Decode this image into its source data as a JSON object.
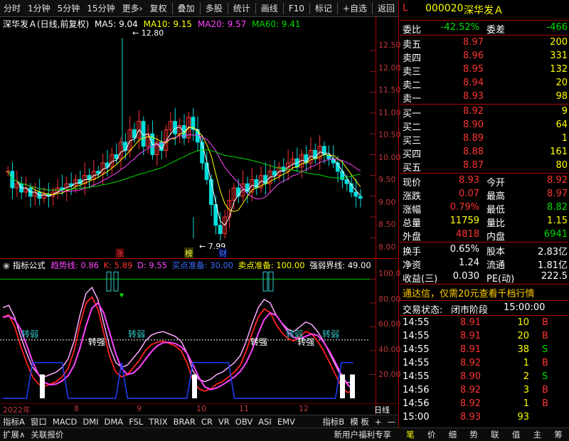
{
  "toolbar": {
    "left": [
      "分时",
      "1分钟",
      "5分钟",
      "15分钟",
      "更多›"
    ],
    "right": [
      "复权",
      "叠加",
      "多股",
      "统计",
      "画线",
      "F10",
      "标记",
      "+自选",
      "返回"
    ]
  },
  "chart": {
    "title": "深华发Ａ(日线,前复权)",
    "ma5": "MA5: 9.04",
    "ma10": "MA10: 9.15",
    "ma20": "MA20: 9.57",
    "ma60": "MA60: 9.41",
    "high_label": "12.80",
    "low_label": "7.99",
    "price_ticks": [
      "12.50",
      "12.00",
      "11.50",
      "11.00",
      "10.50",
      "10.00",
      "9.50",
      "9.00",
      "8.50",
      "8.00"
    ],
    "flags": [
      "涨",
      "榜",
      "财"
    ]
  },
  "indicator": {
    "name": "指标公式",
    "trend": "趋势线: 0.86",
    "k": "K: 5.89",
    "d": "D: 9.55",
    "buy": "买点准备: 30.00",
    "sell": "卖点准备: 100.00",
    "bound": "强弱界线: 49.00",
    "ticks": [
      "100.0",
      "80.00",
      "60.00",
      "40.00",
      "20.00"
    ],
    "labels": [
      "转弱",
      "转强",
      "转弱",
      "转强",
      "转弱",
      "转强",
      "转弱"
    ]
  },
  "timeline": {
    "labels": [
      "2022年",
      "8",
      "9",
      "10",
      "11",
      "12"
    ],
    "period": "日线"
  },
  "tabs": [
    "指标A",
    "窗口",
    "MACD",
    "DMI",
    "DMA",
    "FSL",
    "TRIX",
    "BRAR",
    "CR",
    "VR",
    "OBV",
    "ASI",
    "EMV"
  ],
  "tabs_right": [
    "指标B",
    "模 板",
    "+",
    "—"
  ],
  "bottom": {
    "left": [
      "扩展∧",
      "关联报价"
    ],
    "promo": "新用户福利专享"
  },
  "quote": {
    "flag": "L",
    "code": "000020",
    "name": "深华发Ａ",
    "weibi_label": "委比",
    "weibi": "-42.52%",
    "weicha_label": "委差",
    "weicha": "-466",
    "asks": [
      {
        "l": "卖五",
        "p": "8.97",
        "v": "200"
      },
      {
        "l": "卖四",
        "p": "8.96",
        "v": "331"
      },
      {
        "l": "卖三",
        "p": "8.95",
        "v": "132"
      },
      {
        "l": "卖二",
        "p": "8.94",
        "v": "20"
      },
      {
        "l": "卖一",
        "p": "8.93",
        "v": "98"
      }
    ],
    "bids": [
      {
        "l": "买一",
        "p": "8.92",
        "v": "9"
      },
      {
        "l": "买二",
        "p": "8.90",
        "v": "64"
      },
      {
        "l": "买三",
        "p": "8.89",
        "v": "1"
      },
      {
        "l": "买四",
        "p": "8.88",
        "v": "161"
      },
      {
        "l": "买五",
        "p": "8.87",
        "v": "80"
      }
    ],
    "stats": [
      {
        "l1": "现价",
        "v1": "8.93",
        "l2": "今开",
        "v2": "8.92"
      },
      {
        "l1": "涨跌",
        "v1": "0.07",
        "l2": "最高",
        "v2": "8.97"
      },
      {
        "l1": "涨幅",
        "v1": "0.79%",
        "l2": "最低",
        "v2": "8.82"
      },
      {
        "l1": "总量",
        "v1": "11759",
        "l2": "量比",
        "v2": "1.15"
      },
      {
        "l1": "外盘",
        "v1": "4818",
        "l2": "内盘",
        "v2": "6941"
      }
    ],
    "stats2": [
      {
        "l1": "换手",
        "v1": "0.65%",
        "l2": "股本",
        "v2": "2.83亿"
      },
      {
        "l1": "净资",
        "v1": "1.24",
        "l2": "流通",
        "v2": "1.81亿"
      },
      {
        "l1": "收益(三)",
        "v1": "0.030",
        "l2": "PE(动)",
        "v2": "222.5"
      }
    ],
    "promo": "通达信，仅需20元查看千档行情",
    "status_label": "交易状态:",
    "status": "闭市阶段",
    "status_time": "15:00:00",
    "ticks": [
      {
        "t": "14:55",
        "p": "8.91",
        "v": "10",
        "s": "B"
      },
      {
        "t": "14:55",
        "p": "8.91",
        "v": "20",
        "s": "B"
      },
      {
        "t": "14:55",
        "p": "8.91",
        "v": "38",
        "s": "S"
      },
      {
        "t": "14:55",
        "p": "8.92",
        "v": "1",
        "s": "B"
      },
      {
        "t": "14:55",
        "p": "8.90",
        "v": "2",
        "s": "S"
      },
      {
        "t": "14:56",
        "p": "8.92",
        "v": "3",
        "s": "B"
      },
      {
        "t": "14:56",
        "p": "8.92",
        "v": "1",
        "s": "B"
      },
      {
        "t": "15:00",
        "p": "8.93",
        "v": "93",
        "s": ""
      }
    ],
    "bottom_tabs": [
      "笔",
      "价",
      "细",
      "势",
      "联",
      "值",
      "主",
      "筹"
    ]
  }
}
